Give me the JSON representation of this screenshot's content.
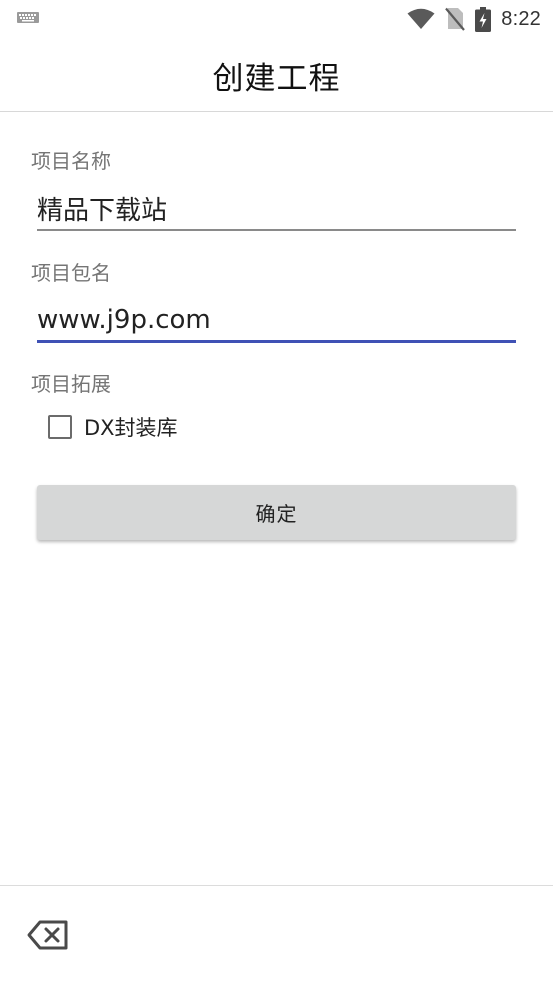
{
  "status_bar": {
    "time": "8:22",
    "icons": [
      "keyboard-icon",
      "wifi-icon",
      "no-sim-icon",
      "battery-charging-icon"
    ]
  },
  "app_bar": {
    "title": "创建工程"
  },
  "form": {
    "project_name": {
      "label": "项目名称",
      "value": "精品下载站"
    },
    "package_name": {
      "label": "项目包名",
      "value": "www.j9p.com"
    },
    "extensions": {
      "label": "项目拓展",
      "options": [
        {
          "label": "DX封装库",
          "checked": false
        }
      ]
    },
    "confirm_label": "确定"
  },
  "bottom_bar": {
    "icons": [
      "backspace-icon"
    ]
  },
  "colors": {
    "accent": "#3f51b5",
    "button_bg": "#d6d7d7",
    "label_gray": "#757575"
  }
}
